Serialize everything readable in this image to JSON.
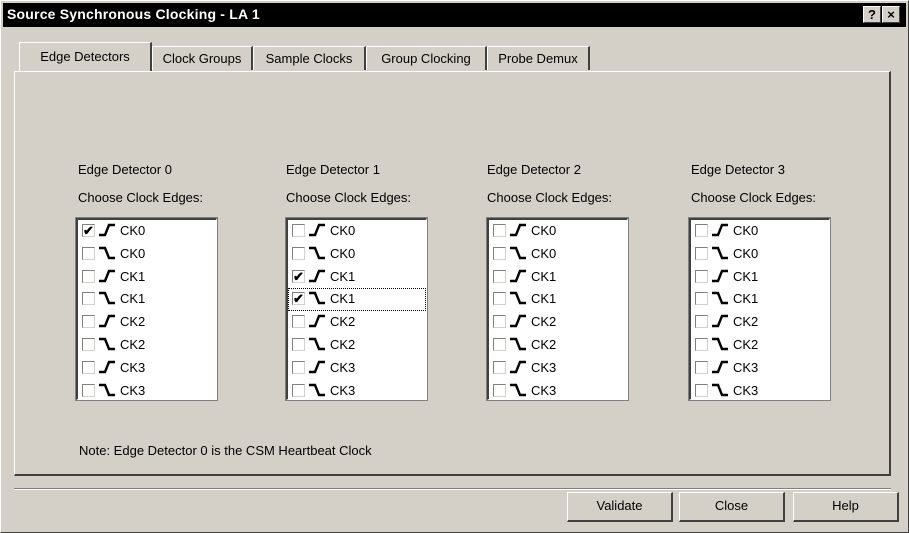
{
  "window": {
    "title": "Source Synchronous Clocking - LA 1",
    "help_glyph": "?",
    "close_glyph": "×"
  },
  "tabs": [
    {
      "label": "Edge Detectors",
      "active": true
    },
    {
      "label": "Clock Groups",
      "active": false
    },
    {
      "label": "Sample Clocks",
      "active": false
    },
    {
      "label": "Group Clocking",
      "active": false
    },
    {
      "label": "Probe Demux",
      "active": false
    }
  ],
  "detectors": [
    {
      "title": "Edge Detector 0",
      "subtitle": "Choose Clock Edges:",
      "items": [
        {
          "edge": "rising-edge-icon",
          "label": "CK0",
          "checked": true
        },
        {
          "edge": "falling-edge-icon",
          "label": "CK0",
          "checked": false
        },
        {
          "edge": "rising-edge-icon",
          "label": "CK1",
          "checked": false
        },
        {
          "edge": "falling-edge-icon",
          "label": "CK1",
          "checked": false
        },
        {
          "edge": "rising-edge-icon",
          "label": "CK2",
          "checked": false
        },
        {
          "edge": "falling-edge-icon",
          "label": "CK2",
          "checked": false
        },
        {
          "edge": "rising-edge-icon",
          "label": "CK3",
          "checked": false
        },
        {
          "edge": "falling-edge-icon",
          "label": "CK3",
          "checked": false
        }
      ]
    },
    {
      "title": "Edge Detector 1",
      "subtitle": "Choose Clock Edges:",
      "items": [
        {
          "edge": "rising-edge-icon",
          "label": "CK0",
          "checked": false
        },
        {
          "edge": "falling-edge-icon",
          "label": "CK0",
          "checked": false
        },
        {
          "edge": "rising-edge-icon",
          "label": "CK1",
          "checked": true
        },
        {
          "edge": "falling-edge-icon",
          "label": "CK1",
          "checked": true,
          "focused": true
        },
        {
          "edge": "rising-edge-icon",
          "label": "CK2",
          "checked": false
        },
        {
          "edge": "falling-edge-icon",
          "label": "CK2",
          "checked": false
        },
        {
          "edge": "rising-edge-icon",
          "label": "CK3",
          "checked": false
        },
        {
          "edge": "falling-edge-icon",
          "label": "CK3",
          "checked": false
        }
      ]
    },
    {
      "title": "Edge Detector 2",
      "subtitle": "Choose Clock Edges:",
      "items": [
        {
          "edge": "rising-edge-icon",
          "label": "CK0",
          "checked": false
        },
        {
          "edge": "falling-edge-icon",
          "label": "CK0",
          "checked": false
        },
        {
          "edge": "rising-edge-icon",
          "label": "CK1",
          "checked": false
        },
        {
          "edge": "falling-edge-icon",
          "label": "CK1",
          "checked": false
        },
        {
          "edge": "rising-edge-icon",
          "label": "CK2",
          "checked": false
        },
        {
          "edge": "falling-edge-icon",
          "label": "CK2",
          "checked": false
        },
        {
          "edge": "rising-edge-icon",
          "label": "CK3",
          "checked": false
        },
        {
          "edge": "falling-edge-icon",
          "label": "CK3",
          "checked": false
        }
      ]
    },
    {
      "title": "Edge Detector 3",
      "subtitle": "Choose Clock Edges:",
      "items": [
        {
          "edge": "rising-edge-icon",
          "label": "CK0",
          "checked": false
        },
        {
          "edge": "falling-edge-icon",
          "label": "CK0",
          "checked": false
        },
        {
          "edge": "rising-edge-icon",
          "label": "CK1",
          "checked": false
        },
        {
          "edge": "falling-edge-icon",
          "label": "CK1",
          "checked": false
        },
        {
          "edge": "rising-edge-icon",
          "label": "CK2",
          "checked": false
        },
        {
          "edge": "falling-edge-icon",
          "label": "CK2",
          "checked": false
        },
        {
          "edge": "rising-edge-icon",
          "label": "CK3",
          "checked": false
        },
        {
          "edge": "falling-edge-icon",
          "label": "CK3",
          "checked": false
        }
      ]
    }
  ],
  "note": "Note:  Edge Detector 0 is the CSM Heartbeat Clock",
  "buttons": {
    "validate": "Validate",
    "close": "Close",
    "help": "Help"
  },
  "check_glyph": "✔"
}
